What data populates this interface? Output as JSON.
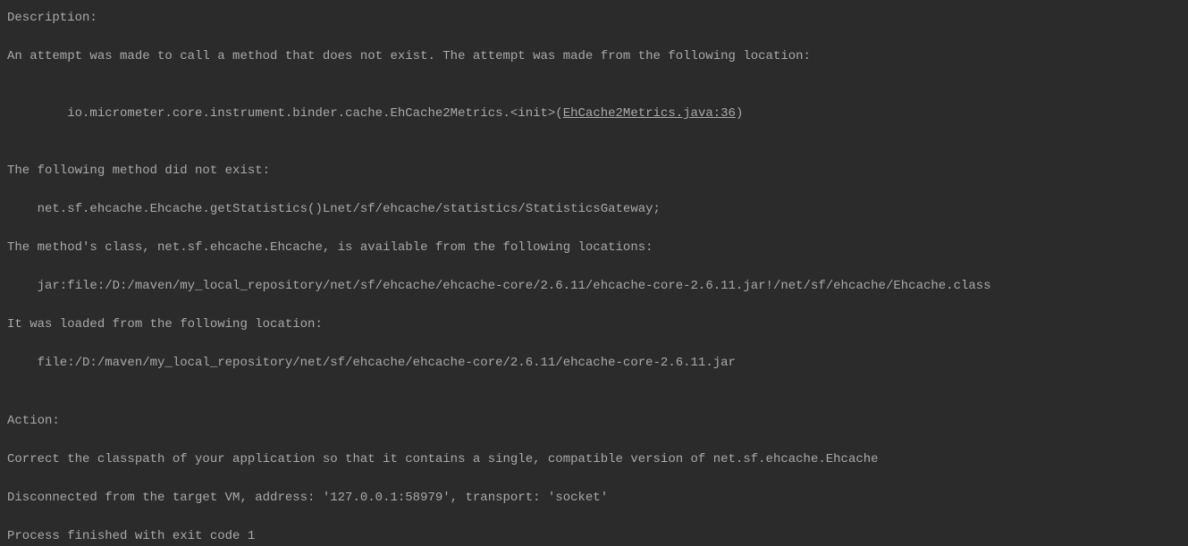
{
  "console": {
    "lines": [
      {
        "text": "Description:",
        "indent": false
      },
      {
        "text": "An attempt was made to call a method that does not exist. The attempt was made from the following location:",
        "indent": false
      },
      {
        "prefix": "    io.micrometer.core.instrument.binder.cache.EhCache2Metrics.<init>(",
        "link": "EhCache2Metrics.java:36",
        "suffix": ")",
        "indent": false,
        "hasLink": true
      },
      {
        "text": "The following method did not exist:",
        "indent": false
      },
      {
        "text": "    net.sf.ehcache.Ehcache.getStatistics()Lnet/sf/ehcache/statistics/StatisticsGateway;",
        "indent": false
      },
      {
        "text": "The method's class, net.sf.ehcache.Ehcache, is available from the following locations:",
        "indent": false
      },
      {
        "text": "    jar:file:/D:/maven/my_local_repository/net/sf/ehcache/ehcache-core/2.6.11/ehcache-core-2.6.11.jar!/net/sf/ehcache/Ehcache.class",
        "indent": false
      },
      {
        "text": "It was loaded from the following location:",
        "indent": false
      },
      {
        "text": "    file:/D:/maven/my_local_repository/net/sf/ehcache/ehcache-core/2.6.11/ehcache-core-2.6.11.jar",
        "indent": false
      },
      {
        "text": "",
        "blank": true
      },
      {
        "text": "Action:",
        "indent": false
      },
      {
        "text": "Correct the classpath of your application so that it contains a single, compatible version of net.sf.ehcache.Ehcache",
        "indent": false
      },
      {
        "text": "Disconnected from the target VM, address: '127.0.0.1:58979', transport: 'socket'",
        "indent": false
      },
      {
        "text": "Process finished with exit code 1",
        "indent": false
      }
    ]
  }
}
